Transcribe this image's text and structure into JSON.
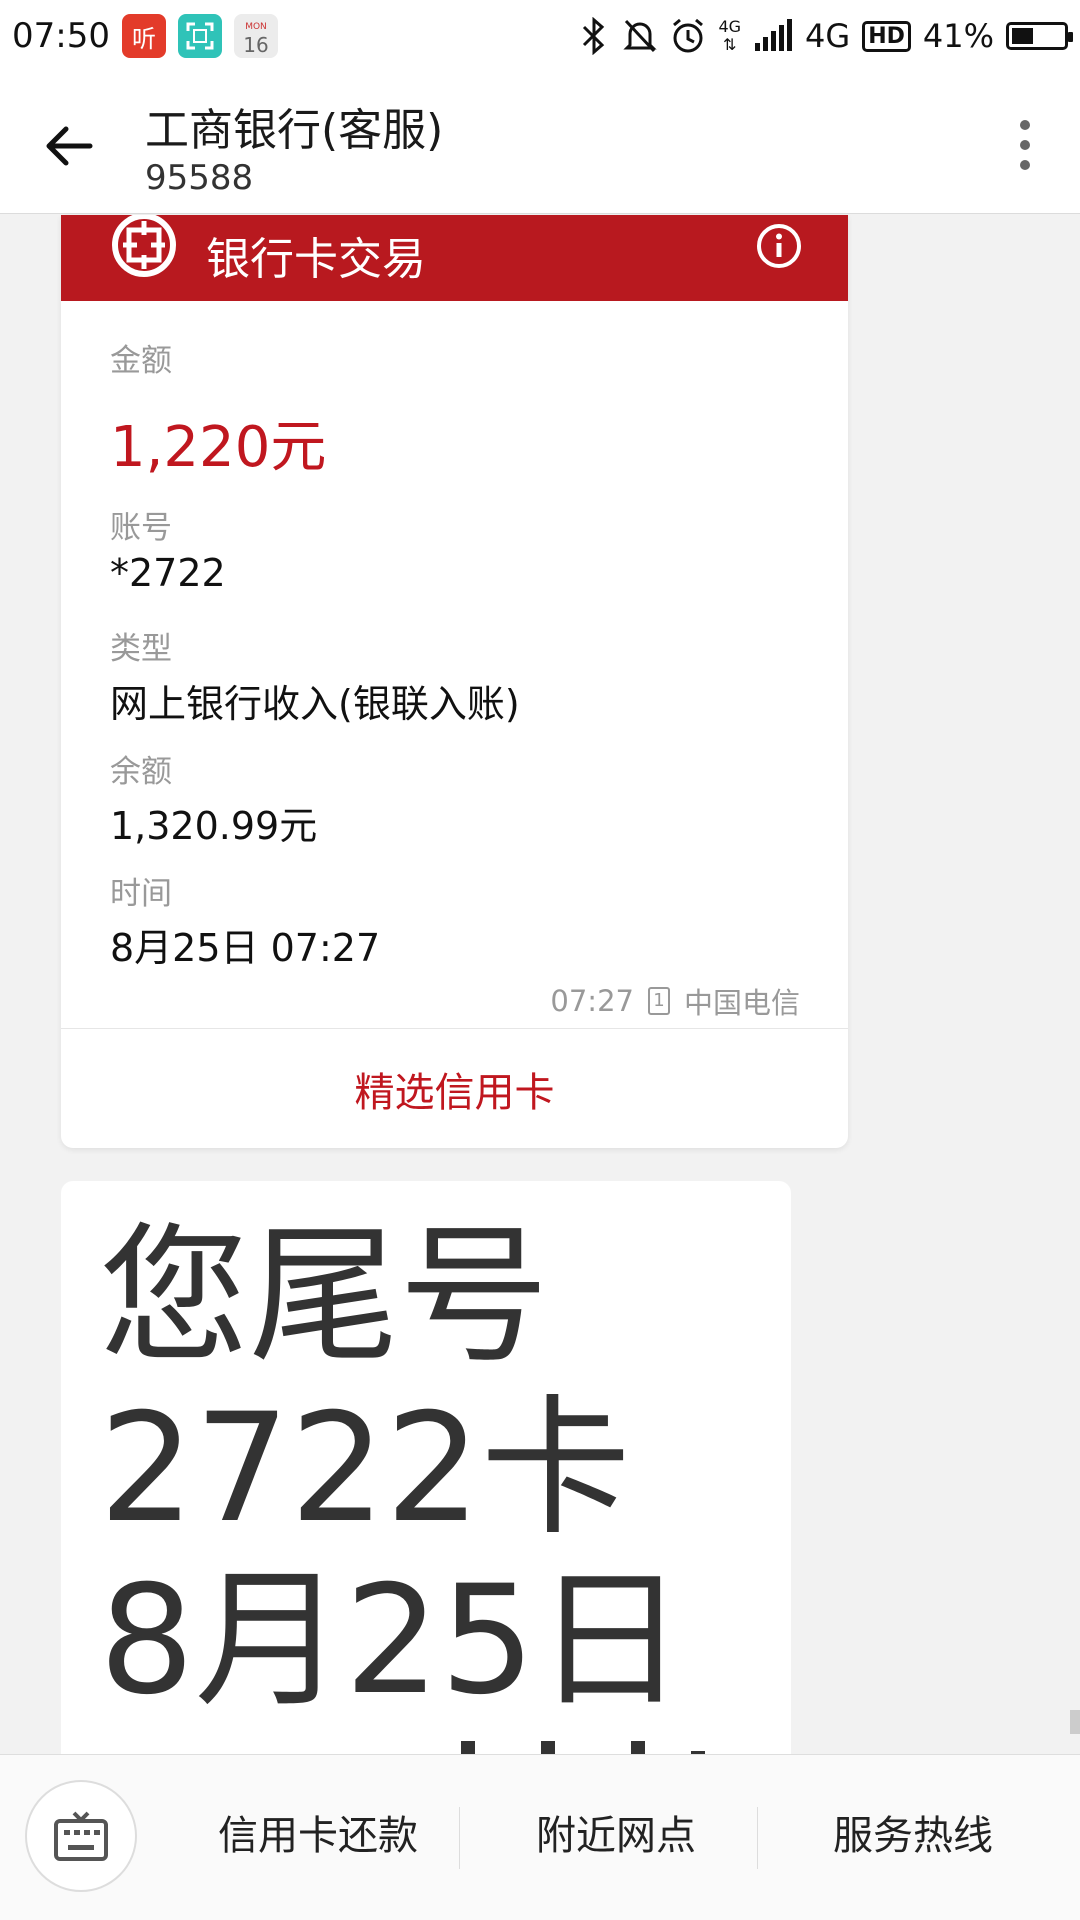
{
  "status_bar": {
    "time": "07:50",
    "apps": [
      {
        "icon": "listen-app-icon",
        "label": "听",
        "color": "#e33b2a"
      },
      {
        "icon": "scanner-app-icon",
        "label": "",
        "color": "#2fc3b8"
      },
      {
        "icon": "calendar-app-icon",
        "label": "16",
        "sub": "MON",
        "color": "#e8e8e8"
      }
    ],
    "network_label": "4G",
    "network_label_small": "4G",
    "hd_label": "HD",
    "battery_text": "41%",
    "battery_level": 0.41
  },
  "header": {
    "contact_name": "工商银行(客服)",
    "contact_number": "95588"
  },
  "card": {
    "title": "银行卡交易",
    "logo": "icbc-logo",
    "brand_color": "#b8191f",
    "fields": {
      "amount_label": "金额",
      "amount_value": "1,220元",
      "account_label": "账号",
      "account_value": "*2722",
      "type_label": "类型",
      "type_value": "网上银行收入(银联入账)",
      "balance_label": "余额",
      "balance_value": "1,320.99元",
      "time_label": "时间",
      "time_value": "8月25日 07:27"
    },
    "meta_time": "07:27",
    "sim_slot": "1",
    "carrier": "中国电信",
    "link_label": "精选信用卡"
  },
  "message": {
    "text": "您尾号\n2722卡\n8月25日"
  },
  "bottom_menu": {
    "items": [
      "信用卡还款",
      "附近网点",
      "服务热线"
    ]
  }
}
